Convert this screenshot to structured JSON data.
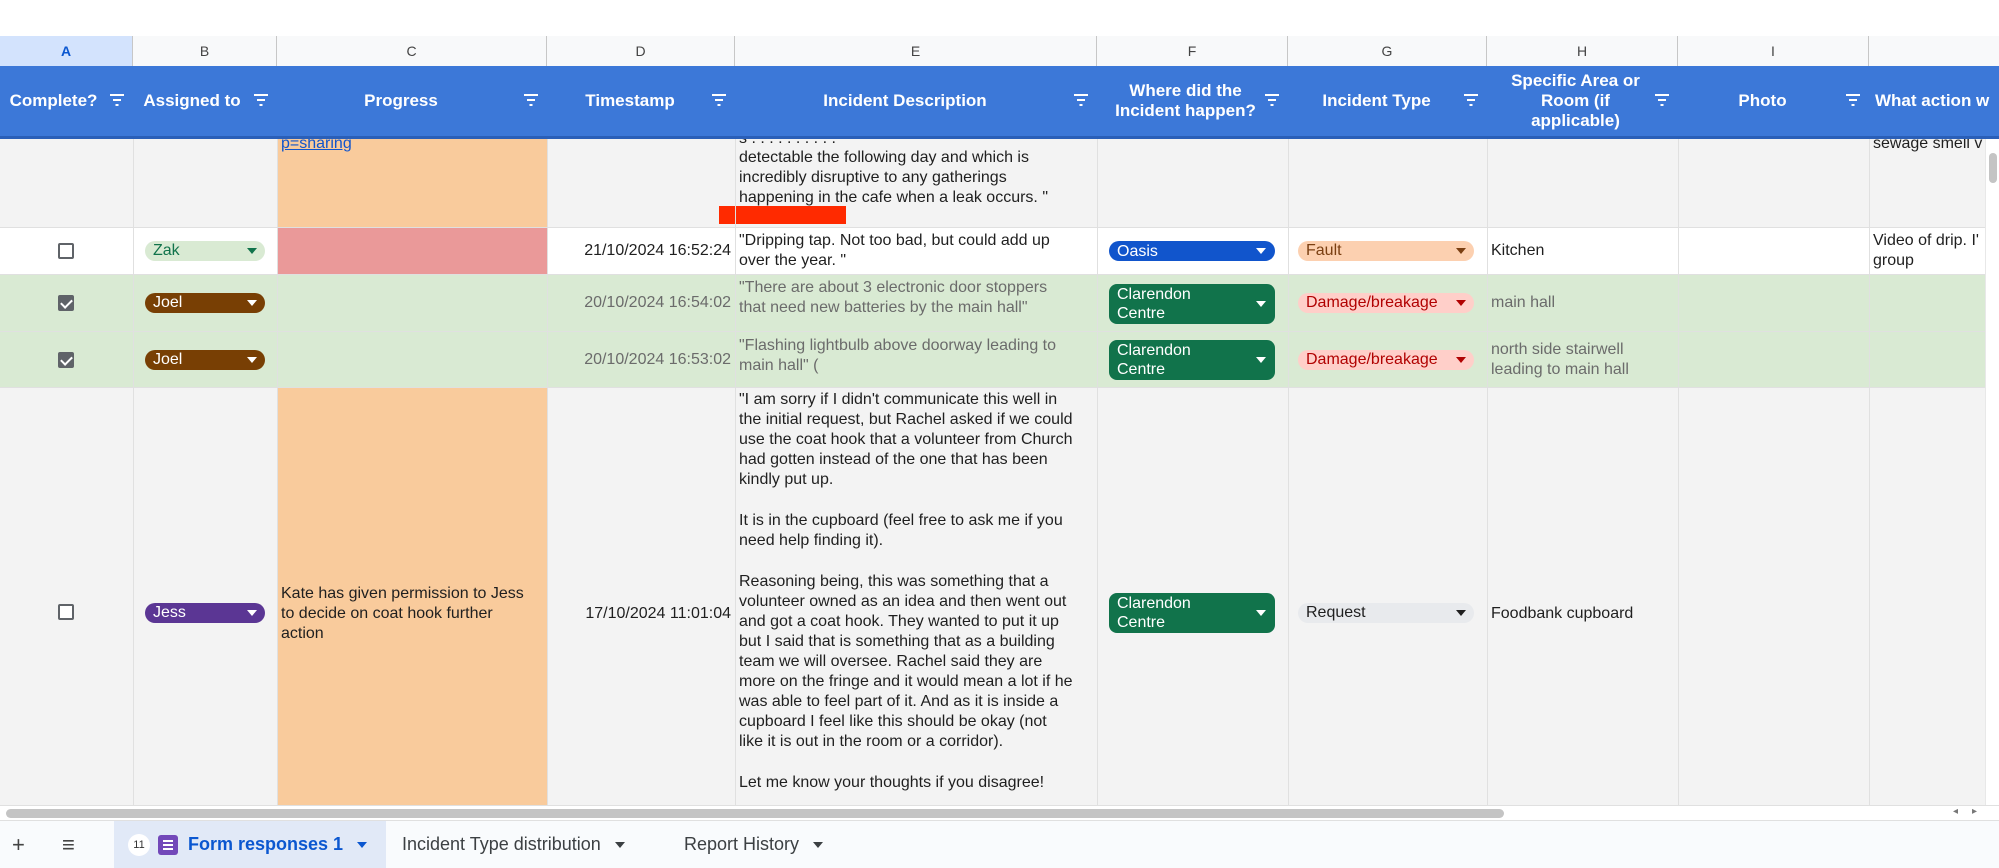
{
  "columns": [
    "A",
    "B",
    "C",
    "D",
    "E",
    "F",
    "G",
    "H",
    "I"
  ],
  "headers": {
    "complete": "Complete?",
    "assigned": "Assigned to",
    "progress": "Progress",
    "timestamp": "Timestamp",
    "description": "Incident Description",
    "where": "Where did the Incident happen?",
    "type": "Incident Type",
    "area": "Specific Area or Room (if applicable)",
    "photo": "Photo",
    "action": "What action w"
  },
  "rows": [
    {
      "progress_link": "p=sharing",
      "description_lines": [
        "detectable the following day and which is",
        "incredibly disruptive to any gatherings",
        "happening in the cafe when a leak occurs. \""
      ],
      "action": "sewage smell v",
      "progress_color": "#f9cb9c"
    },
    {
      "complete": false,
      "assigned": "Zak",
      "assigned_color": "#d9ead3",
      "timestamp": "21/10/2024 16:52:24",
      "description_lines": [
        "\"Dripping tap. Not too bad, but could add up",
        "over the year. \""
      ],
      "where": "Oasis",
      "where_color": "#1155cc",
      "type": "Fault",
      "type_color": "#fcd0b0",
      "area": "Kitchen",
      "action_lines": [
        "Video of drip. I'",
        "group"
      ],
      "progress_color": "#ea9999"
    },
    {
      "complete": true,
      "assigned": "Joel",
      "assigned_color": "#783f04",
      "timestamp": "20/10/2024 16:54:02",
      "description_lines": [
        "\"There are about 3 electronic door stoppers",
        "that need new batteries by the main hall\""
      ],
      "where_lines": [
        "Clarendon",
        "Centre"
      ],
      "where_color": "#11734b",
      "type": "Damage/breakage",
      "type_color": "#ffcfc9",
      "area": "main hall",
      "row_color": "#d9ead3"
    },
    {
      "complete": true,
      "assigned": "Joel",
      "assigned_color": "#783f04",
      "timestamp": "20/10/2024 16:53:02",
      "description_lines": [
        "\"Flashing lightbulb above doorway leading to",
        "main hall\" ("
      ],
      "where_lines": [
        "Clarendon",
        "Centre"
      ],
      "where_color": "#11734b",
      "type": "Damage/breakage",
      "type_color": "#ffcfc9",
      "area_lines": [
        "north side stairwell",
        "leading to main hall"
      ],
      "row_color": "#d9ead3"
    },
    {
      "complete": false,
      "assigned": "Jess",
      "assigned_color": "#5b3694",
      "progress_lines": [
        "Kate has given permission to Jess",
        "to decide on coat hook further",
        "action"
      ],
      "timestamp": "17/10/2024 11:01:04",
      "description_lines": [
        "\"I am sorry if I didn't communicate this well in",
        "the initial request, but Rachel asked if we could",
        "use the coat hook that a volunteer from Church",
        "had gotten instead of the one that has been",
        "kindly put up.",
        "",
        "It is in the cupboard (feel free to ask me if you",
        "need help finding it).",
        "",
        "Reasoning being, this was something that a",
        "volunteer owned as an idea and then went out",
        "and got a coat hook. They wanted to put it up",
        "but I said that is something that as a building",
        "team we will oversee. Rachel said they are",
        "more on the fringe and it would mean a lot if he",
        "was able to feel part of it. And as it is inside a",
        "cupboard I feel like this should be okay (not",
        "like it is out in the room or a corridor).",
        "",
        "Let me know your thoughts if you disagree!"
      ],
      "where_lines": [
        "Clarendon",
        "Centre"
      ],
      "where_color": "#11734b",
      "type": "Request",
      "type_color": "#e8eaed",
      "area": "Foodbank cupboard",
      "progress_color": "#f9cb9c"
    }
  ],
  "tabs": {
    "count_badge": "11",
    "active": "Form responses 1",
    "t2": "Incident Type distribution",
    "t3": "Report History"
  }
}
